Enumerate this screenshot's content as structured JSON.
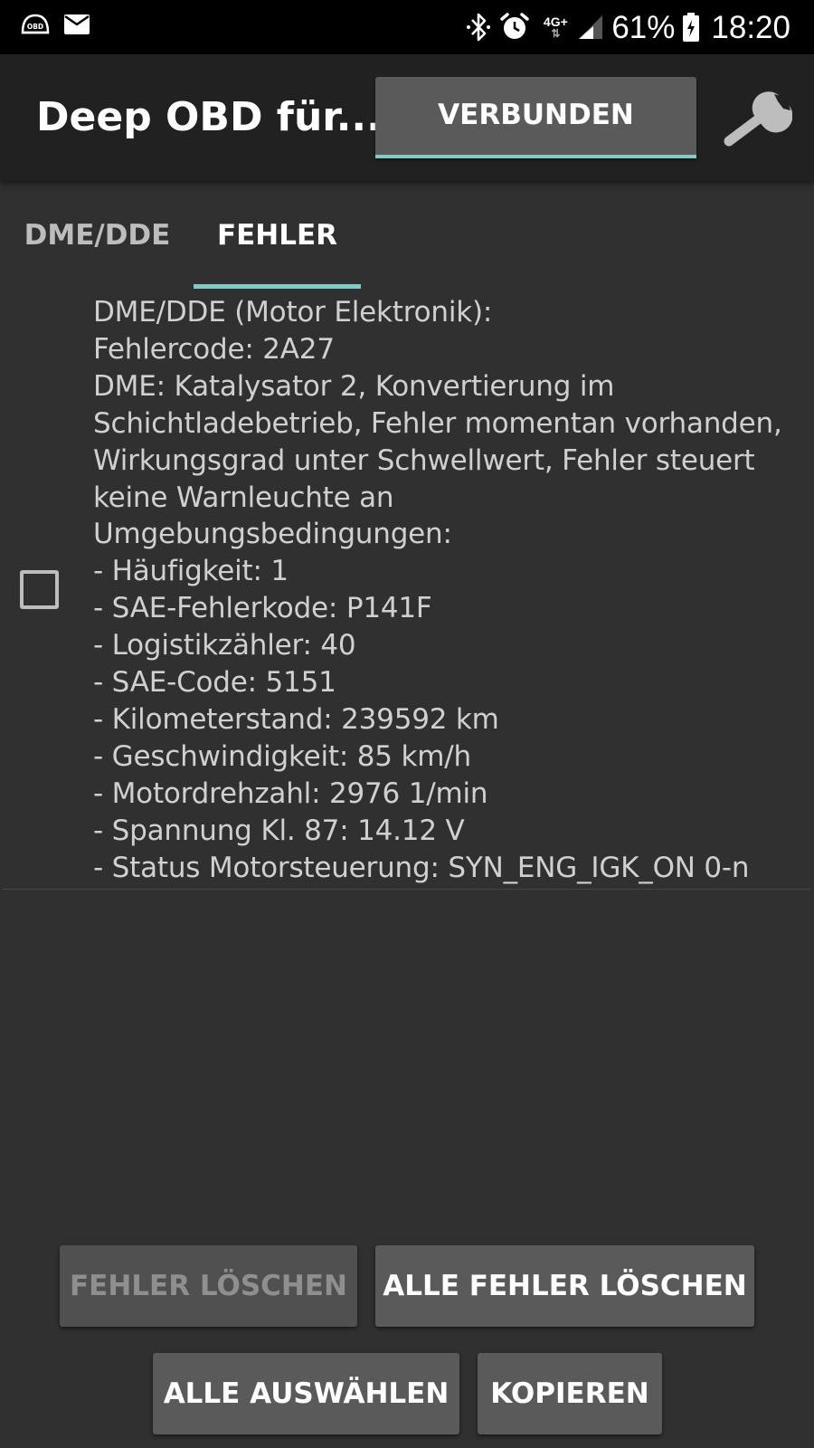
{
  "status_bar": {
    "left_icons": [
      "obd-icon",
      "mail-icon"
    ],
    "obd_icon_label": "OBD",
    "network_label": "4G+",
    "battery_percent": "61%",
    "time": "18:20",
    "right_icons": [
      "bluetooth-icon",
      "alarm-icon",
      "network-4g-icon",
      "signal-icon",
      "battery-icon"
    ]
  },
  "action_bar": {
    "title": "Deep OBD für...",
    "connect_label": "VERBUNDEN",
    "accent_color": "#80cbc4"
  },
  "tabs": [
    {
      "label": "DME/DDE",
      "selected": false
    },
    {
      "label": "FEHLER",
      "selected": true
    }
  ],
  "faults": [
    {
      "checked": false,
      "lines": [
        "DME/DDE (Motor Elektronik):",
        "Fehlercode: 2A27",
        "DME: Katalysator 2, Konvertierung im",
        "Schichtladebetrieb, Fehler momentan vorhanden,",
        "Wirkungsgrad unter Schwellwert, Fehler steuert",
        "keine Warnleuchte an",
        "Umgebungsbedingungen:",
        "- Häufigkeit: 1",
        "- SAE-Fehlerkode: P141F",
        "- Logistikzähler: 40",
        "- SAE-Code: 5151",
        "- Kilometerstand: 239592 km",
        "- Geschwindigkeit: 85 km/h",
        "- Motordrehzahl: 2976 1/min",
        "- Spannung Kl. 87: 14.12 V",
        "- Status Motorsteuerung: SYN_ENG_IGK_ON 0-n"
      ]
    }
  ],
  "buttons": {
    "clear_errors": "FEHLER LÖSCHEN",
    "clear_all_errors": "ALLE FEHLER LÖSCHEN",
    "select_all": "ALLE AUSWÄHLEN",
    "copy": "KOPIEREN"
  }
}
